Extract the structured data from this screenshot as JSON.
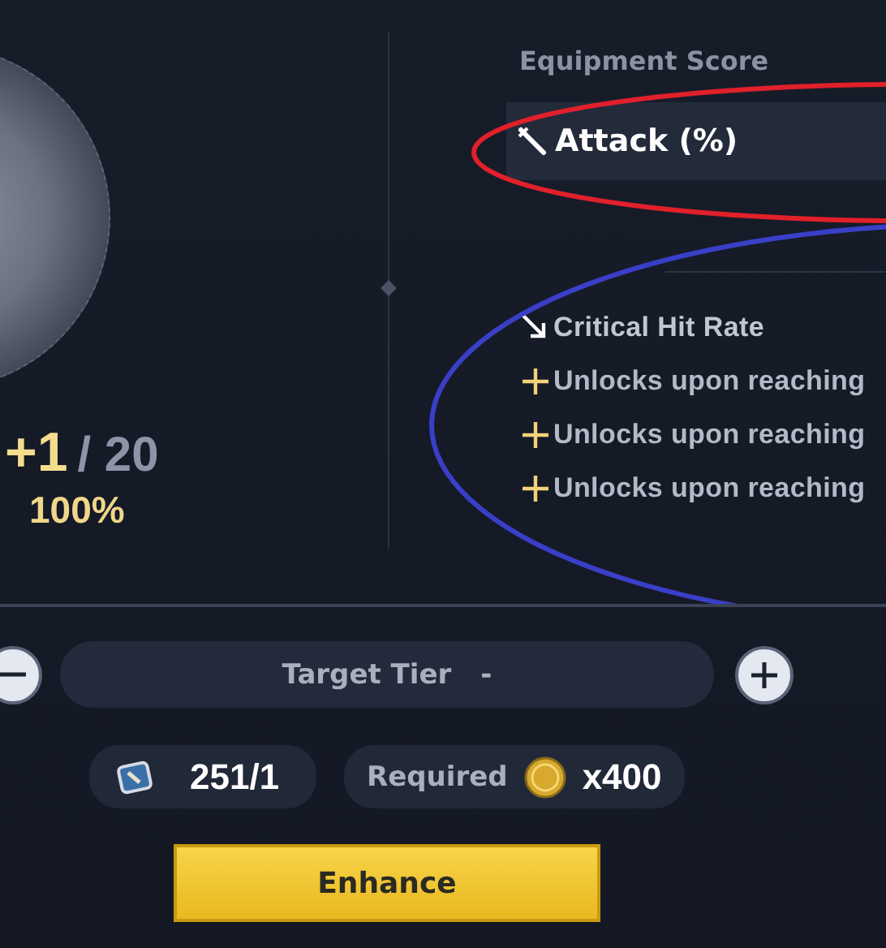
{
  "equipment": {
    "level": "+1",
    "max_level": "/ 20",
    "rate": "100%"
  },
  "stats": {
    "title": "Equipment Score",
    "main_stat": "Attack (%)",
    "sub_stats": [
      {
        "kind": "stat",
        "label": "Critical Hit Rate"
      },
      {
        "kind": "locked",
        "label": "Unlocks upon reaching"
      },
      {
        "kind": "locked",
        "label": "Unlocks upon reaching"
      },
      {
        "kind": "locked",
        "label": "Unlocks upon reaching"
      }
    ]
  },
  "annotations": [
    {
      "color": "#e0202a"
    },
    {
      "color": "#3a3fc8"
    }
  ],
  "target": {
    "label": "Target Tier",
    "value": "-"
  },
  "materials": {
    "count": "251/1",
    "required_label": "Required",
    "required_amount": "x400"
  },
  "action": "Enhance"
}
